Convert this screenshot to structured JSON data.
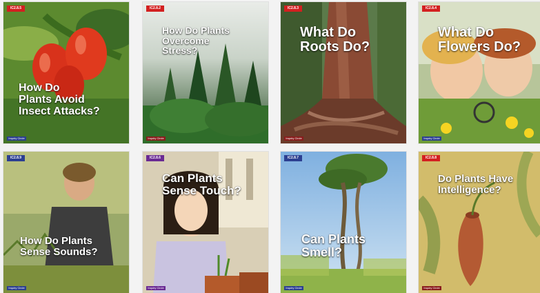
{
  "books": [
    {
      "id": "b1",
      "title": "How Do\nPlants Avoid\nInsect Attacks?",
      "badge": "IC2.8.5",
      "footer": "Inquiry Circle",
      "badge_color": "#d32020",
      "footer_color": "#2c3f91"
    },
    {
      "id": "b2",
      "title": "How Do Plants\nOvercome\nStress?",
      "badge": "IC2.8.2",
      "footer": "Inquiry Circle",
      "badge_color": "#d32020",
      "footer_color": "#8a1d1d"
    },
    {
      "id": "b3",
      "title": "What Do\nRoots Do?",
      "badge": "IC2.8.3",
      "footer": "Inquiry Circle",
      "badge_color": "#d32020",
      "footer_color": "#8a1d1d"
    },
    {
      "id": "b4",
      "title": "What Do\nFlowers Do?",
      "badge": "IC2.8.4",
      "footer": "Inquiry Circle",
      "badge_color": "#d32020",
      "footer_color": "#2c3f91"
    },
    {
      "id": "b5",
      "title": "How Do Plants\nSense Sounds?",
      "badge": "IC2.8.9",
      "footer": "Inquiry Circle",
      "badge_color": "#2c3f91",
      "footer_color": "#2c3f91"
    },
    {
      "id": "b6",
      "title": "Can Plants\nSense Touch?",
      "badge": "IC2.8.6",
      "footer": "Inquiry Circle",
      "badge_color": "#6a2a93",
      "footer_color": "#6a2a93"
    },
    {
      "id": "b7",
      "title": "Can Plants\nSmell?",
      "badge": "IC2.8.7",
      "footer": "Inquiry Circle",
      "badge_color": "#2c3f91",
      "footer_color": "#2c3f91"
    },
    {
      "id": "b8",
      "title": "Do Plants Have\nIntelligence?",
      "badge": "IC2.8.8",
      "footer": "Inquiry Circle",
      "badge_color": "#d32020",
      "footer_color": "#8a1d1d"
    }
  ]
}
